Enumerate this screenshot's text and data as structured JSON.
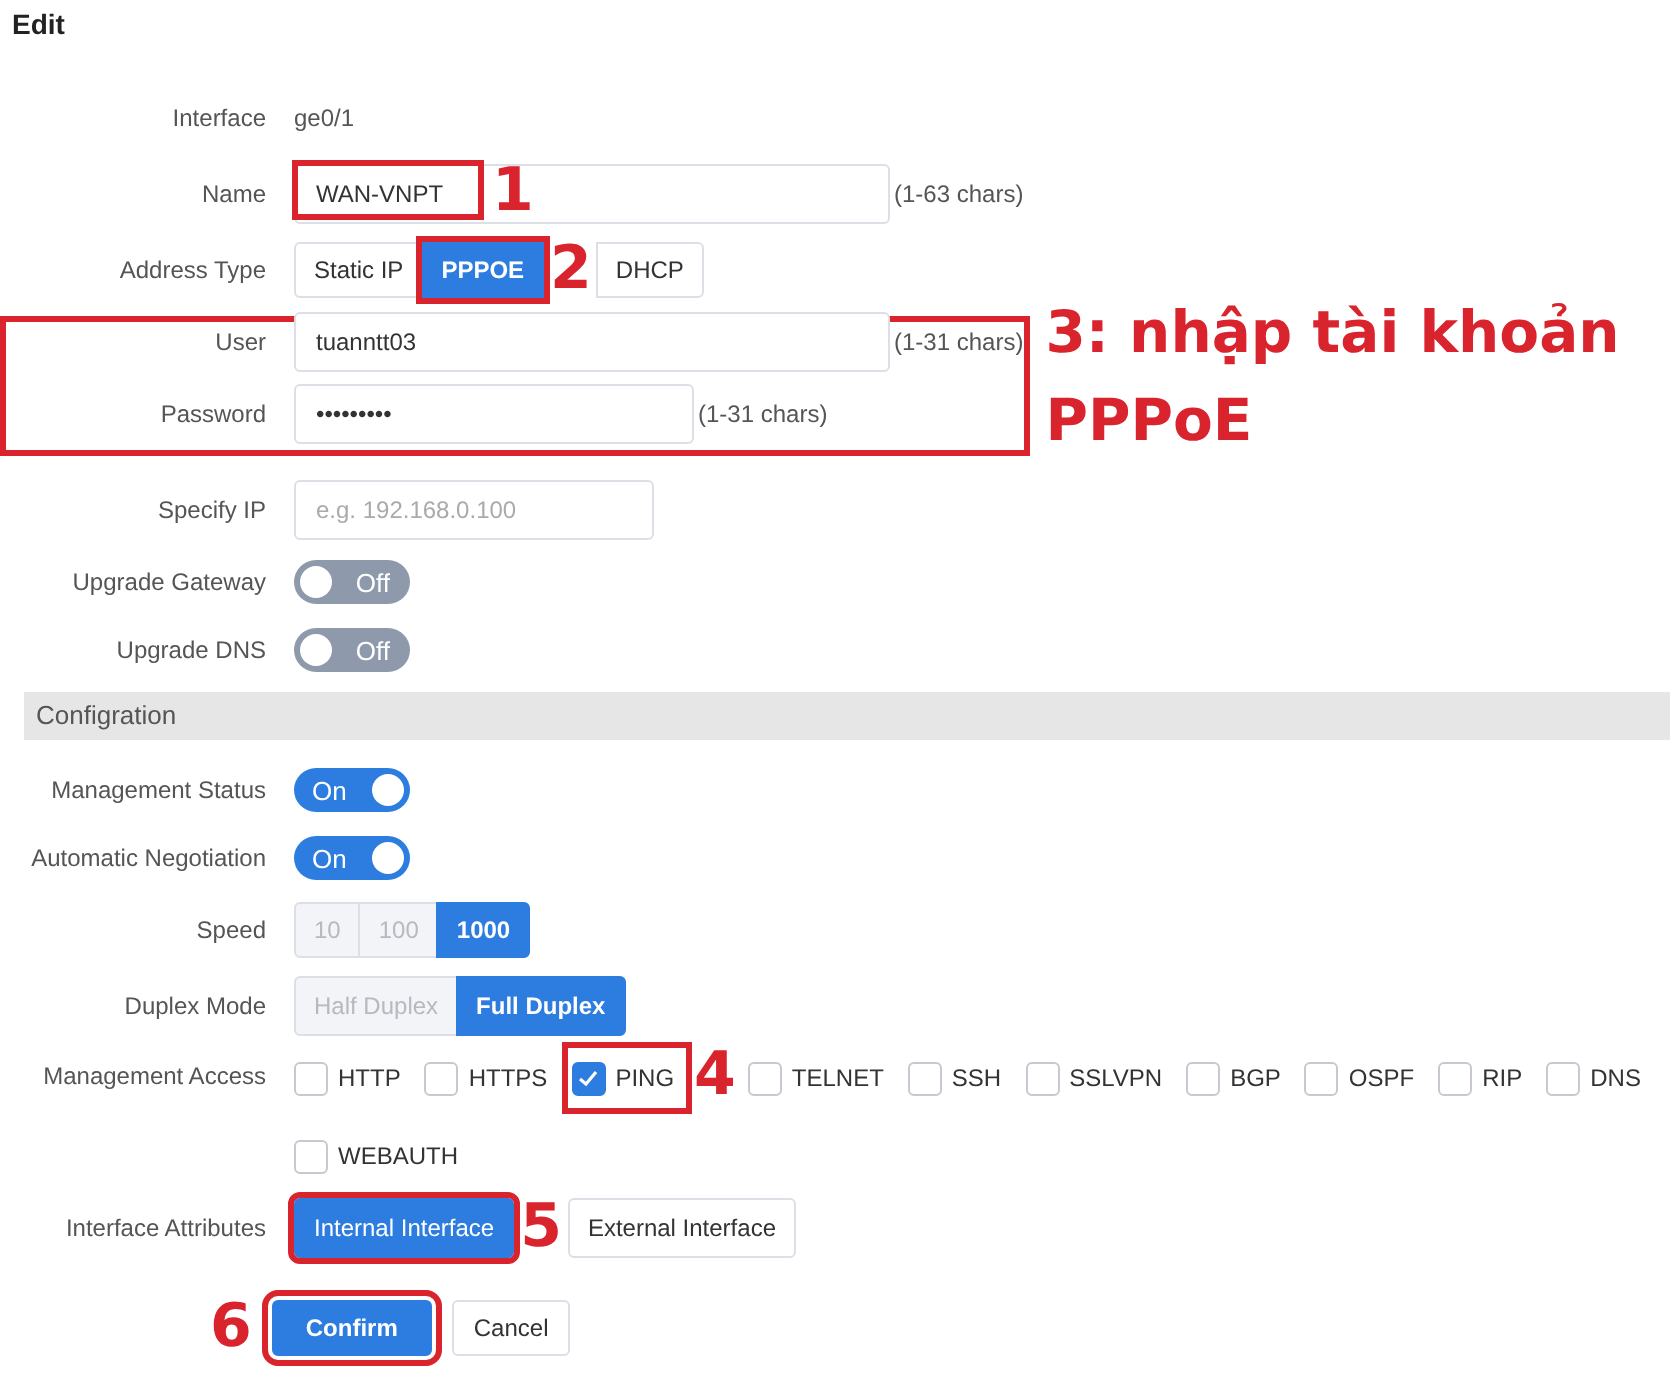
{
  "title": "Edit",
  "interface": {
    "label": "Interface",
    "value": "ge0/1"
  },
  "name": {
    "label": "Name",
    "value": "WAN-VNPT",
    "hint": "(1-63 chars)",
    "annotation": "1"
  },
  "address_type": {
    "label": "Address Type",
    "options": [
      {
        "label": "Static IP",
        "selected": false
      },
      {
        "label": "PPPOE",
        "selected": true,
        "annotation": "2"
      },
      {
        "label": "DHCP",
        "selected": false
      }
    ]
  },
  "account_note": "3: nhập tài khoản PPPoE",
  "user": {
    "label": "User",
    "value": "tuanntt03",
    "hint": "(1-31 chars)"
  },
  "password": {
    "label": "Password",
    "value": "•••••••••",
    "hint": "(1-31 chars)"
  },
  "specify_ip": {
    "label": "Specify IP",
    "placeholder": "e.g. 192.168.0.100"
  },
  "toggles_top": [
    {
      "label": "Upgrade Gateway",
      "on": false,
      "state_text": "Off"
    },
    {
      "label": "Upgrade DNS",
      "on": false,
      "state_text": "Off"
    }
  ],
  "section": {
    "title": "Configration"
  },
  "toggles_config": [
    {
      "label": "Management Status",
      "on": true,
      "state_text": "On"
    },
    {
      "label": "Automatic Negotiation",
      "on": true,
      "state_text": "On"
    }
  ],
  "speed": {
    "label": "Speed",
    "options": [
      {
        "label": "10",
        "selected": false,
        "disabled": true
      },
      {
        "label": "100",
        "selected": false,
        "disabled": true
      },
      {
        "label": "1000",
        "selected": true,
        "disabled": false
      }
    ]
  },
  "duplex_mode": {
    "label": "Duplex Mode",
    "options": [
      {
        "label": "Half Duplex",
        "selected": false,
        "disabled": true
      },
      {
        "label": "Full Duplex",
        "selected": true,
        "disabled": false
      }
    ]
  },
  "management_access": {
    "label": "Management Access",
    "options": [
      {
        "label": "HTTP",
        "checked": false
      },
      {
        "label": "HTTPS",
        "checked": false
      },
      {
        "label": "PING",
        "checked": true,
        "annotation": "4"
      },
      {
        "label": "TELNET",
        "checked": false
      },
      {
        "label": "SSH",
        "checked": false
      },
      {
        "label": "SSLVPN",
        "checked": false
      },
      {
        "label": "BGP",
        "checked": false
      },
      {
        "label": "OSPF",
        "checked": false
      },
      {
        "label": "RIP",
        "checked": false
      },
      {
        "label": "DNS",
        "checked": false
      },
      {
        "label": "WEBAUTH",
        "checked": false
      }
    ]
  },
  "interface_attributes": {
    "label": "Interface Attributes",
    "options": [
      {
        "label": "Internal Interface",
        "selected": true,
        "annotation": "5"
      },
      {
        "label": "External Interface",
        "selected": false
      }
    ]
  },
  "buttons": [
    {
      "label": "Confirm",
      "kind": "primary",
      "annotation": "6"
    },
    {
      "label": "Cancel",
      "kind": "secondary"
    }
  ]
}
